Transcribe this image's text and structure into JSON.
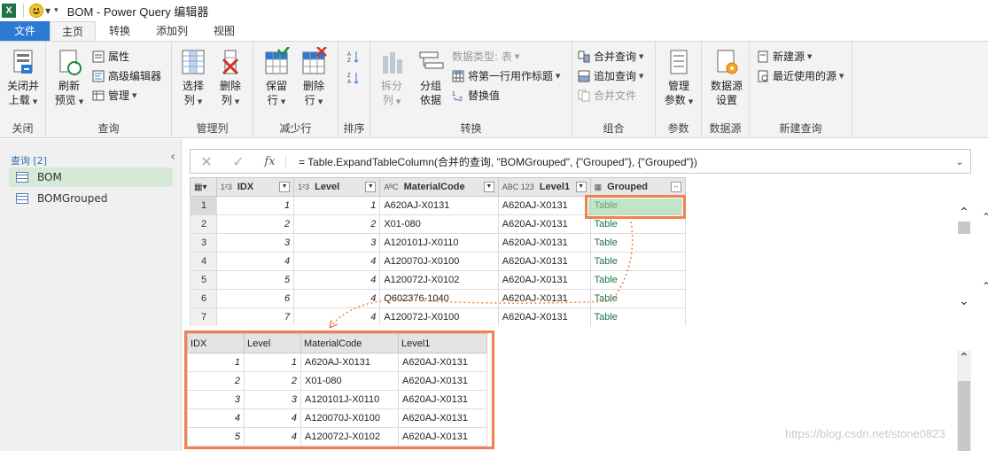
{
  "window": {
    "title": "BOM - Power Query 编辑器",
    "app_badge": "X"
  },
  "tabs": [
    {
      "label": "文件"
    },
    {
      "label": "主页"
    },
    {
      "label": "转换"
    },
    {
      "label": "添加列"
    },
    {
      "label": "视图"
    }
  ],
  "ribbon": {
    "close": {
      "btn_line1": "关闭并",
      "btn_line2": "上载",
      "label": "关闭"
    },
    "query": {
      "refresh_line1": "刷新",
      "refresh_line2": "预览",
      "properties": "属性",
      "advanced_editor": "高级编辑器",
      "manage": "管理",
      "label": "查询"
    },
    "manage_cols": {
      "choose_line1": "选择",
      "choose_line2": "列",
      "remove_line1": "删除",
      "remove_line2": "列",
      "label": "管理列"
    },
    "reduce_rows": {
      "keep_line1": "保留",
      "keep_line2": "行",
      "remove_line1": "删除",
      "remove_line2": "行",
      "label": "减少行"
    },
    "sort": {
      "label": "排序"
    },
    "transform": {
      "split_line1": "拆分",
      "split_line2": "列",
      "group_line1": "分组",
      "group_line2": "依据",
      "datatype": "数据类型: 表",
      "first_row": "将第一行用作标题",
      "replace": "替换值",
      "label": "转换"
    },
    "combine": {
      "merge": "合并查询",
      "append": "追加查询",
      "combine_files": "合并文件",
      "label": "组合"
    },
    "params": {
      "btn_line1": "管理",
      "btn_line2": "参数",
      "label": "参数"
    },
    "datasource": {
      "btn_line1": "数据源",
      "btn_line2": "设置",
      "label": "数据源"
    },
    "newquery": {
      "new_source": "新建源",
      "recent": "最近使用的源",
      "label": "新建查询"
    }
  },
  "queries": {
    "header": "查询 [2]",
    "items": [
      {
        "name": "BOM"
      },
      {
        "name": "BOMGrouped"
      }
    ]
  },
  "formula": "= Table.ExpandTableColumn(合并的查询, \"BOMGrouped\", {\"Grouped\"}, {\"Grouped\"})",
  "grid": {
    "columns": [
      {
        "type": "1²3",
        "name": "IDX"
      },
      {
        "type": "1²3",
        "name": "Level"
      },
      {
        "type": "AᴮC",
        "name": "MaterialCode"
      },
      {
        "type": "ABC 123",
        "name": "Level1"
      },
      {
        "type": "",
        "name": "Grouped"
      }
    ],
    "rows": [
      [
        "1",
        "1",
        "1",
        "A620AJ-X0131",
        "A620AJ-X0131",
        "Table"
      ],
      [
        "2",
        "2",
        "2",
        "X01-080",
        "A620AJ-X0131",
        "Table"
      ],
      [
        "3",
        "3",
        "3",
        "A120101J-X0110",
        "A620AJ-X0131",
        "Table"
      ],
      [
        "4",
        "4",
        "4",
        "A120070J-X0100",
        "A620AJ-X0131",
        "Table"
      ],
      [
        "5",
        "5",
        "4",
        "A120072J-X0102",
        "A620AJ-X0131",
        "Table"
      ],
      [
        "6",
        "6",
        "4",
        "Q602376-1040",
        "A620AJ-X0131",
        "Table"
      ],
      [
        "7",
        "7",
        "4",
        "A120072J-X0100",
        "A620AJ-X0131",
        "Table"
      ]
    ]
  },
  "preview": {
    "columns": [
      "IDX",
      "Level",
      "MaterialCode",
      "Level1"
    ],
    "rows": [
      [
        "1",
        "1",
        "A620AJ-X0131",
        "A620AJ-X0131"
      ],
      [
        "2",
        "2",
        "X01-080",
        "A620AJ-X0131"
      ],
      [
        "3",
        "3",
        "A120101J-X0110",
        "A620AJ-X0131"
      ],
      [
        "4",
        "4",
        "A120070J-X0100",
        "A620AJ-X0131"
      ],
      [
        "5",
        "4",
        "A120072J-X0102",
        "A620AJ-X0131"
      ]
    ]
  },
  "watermark": "https://blog.csdn.net/stone0823",
  "colors": {
    "accent": "#2b79d3",
    "highlight": "#f08050",
    "excel_green": "#1e7145"
  }
}
